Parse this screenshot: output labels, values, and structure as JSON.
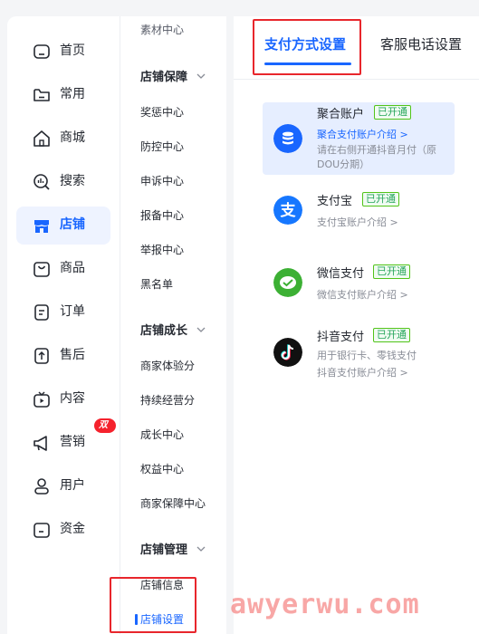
{
  "primary_nav": [
    {
      "label": "首页",
      "icon": "home-icon"
    },
    {
      "label": "常用",
      "icon": "folder-icon"
    },
    {
      "label": "商城",
      "icon": "store-house-icon"
    },
    {
      "label": "搜索",
      "icon": "search-chart-icon"
    },
    {
      "label": "店铺",
      "icon": "shop-icon",
      "active": true
    },
    {
      "label": "商品",
      "icon": "bag-icon"
    },
    {
      "label": "订单",
      "icon": "order-icon"
    },
    {
      "label": "售后",
      "icon": "aftersale-icon"
    },
    {
      "label": "内容",
      "icon": "tv-icon"
    },
    {
      "label": "营销",
      "icon": "megaphone-icon",
      "badge": "双11"
    },
    {
      "label": "用户",
      "icon": "user-icon"
    },
    {
      "label": "资金",
      "icon": "wallet-icon"
    }
  ],
  "secondary_nav": {
    "top_cut": "素材中心",
    "groups": [
      {
        "title": "店铺保障",
        "items": [
          "奖惩中心",
          "防控中心",
          "申诉中心",
          "报备中心",
          "举报中心",
          "黑名单"
        ]
      },
      {
        "title": "店铺成长",
        "items": [
          "商家体验分",
          "持续经营分",
          "成长中心",
          "权益中心",
          "商家保障中心"
        ]
      },
      {
        "title": "店铺管理",
        "items": [
          "店铺信息",
          "店铺设置"
        ]
      }
    ],
    "active_item": "店铺设置"
  },
  "tabs": [
    {
      "label": "支付方式设置",
      "active": true
    },
    {
      "label": "客服电话设置",
      "active": false
    }
  ],
  "payment_methods": [
    {
      "name": "聚合账户",
      "status": "已开通",
      "link": "聚合支付账户介绍 >",
      "desc": "请在右侧开通抖音月付（原DOU分期）",
      "selected": true,
      "color": "#1966ff"
    },
    {
      "name": "支付宝",
      "status": "已开通",
      "link": "支付宝账户介绍 >",
      "color": "#1677ff"
    },
    {
      "name": "微信支付",
      "status": "已开通",
      "link": "微信支付账户介绍 >",
      "color": "#3cb034"
    },
    {
      "name": "抖音支付",
      "status": "已开通",
      "desc": "用于银行卡、零钱支付",
      "link": "抖音支付账户介绍 >",
      "color": "#111111"
    }
  ],
  "watermark": "awyerwu.com"
}
